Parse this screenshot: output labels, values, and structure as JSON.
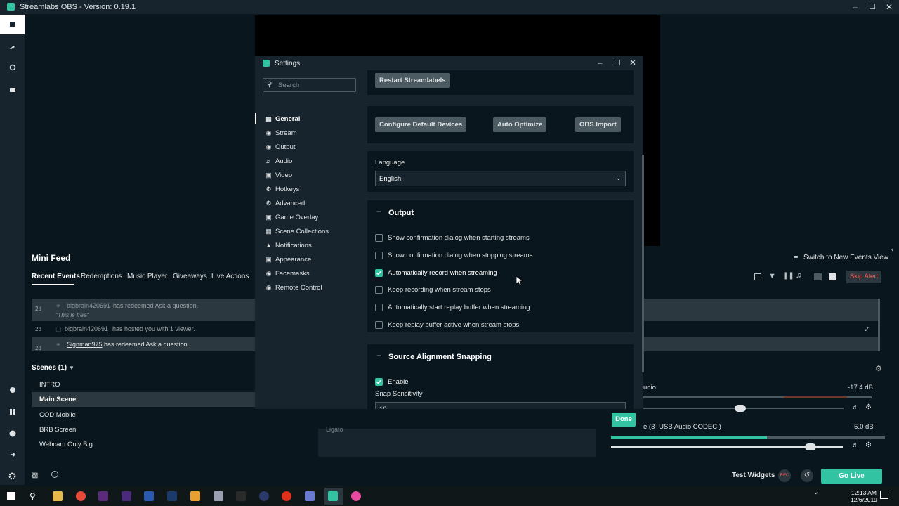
{
  "window": {
    "title": "Streamlabs OBS - Version: 0.19.1"
  },
  "mini_feed": {
    "title": "Mini Feed",
    "tabs": [
      "Recent Events",
      "Redemptions",
      "Music Player",
      "Giveaways",
      "Live Actions"
    ],
    "events": [
      {
        "age": "2d",
        "user": "bigbrain420691",
        "text": "has redeemed Ask a question.",
        "quote": "\"This is free\""
      },
      {
        "age": "2d",
        "user": "bigbrain420691",
        "text": "has hosted you with 1 viewer."
      },
      {
        "age": "2d",
        "user": "Signman975",
        "text": "has redeemed Ask a question."
      }
    ],
    "switch_label": "Switch to New Events View",
    "skip_alert": "Skip Alert"
  },
  "scenes": {
    "title": "Scenes (1)",
    "items": [
      "INTRO",
      "Main Scene",
      "COD Mobile",
      "BRB Screen",
      "Webcam Only Big"
    ],
    "selected": "Main Scene"
  },
  "sources": {
    "partial_item": "Ligato"
  },
  "mixer": {
    "items": [
      {
        "label": "udio",
        "db": "-17.4 dB"
      },
      {
        "label": "e (3- USB Audio CODEC )",
        "db": "-5.0 dB"
      }
    ]
  },
  "footer": {
    "test_widgets": "Test Widgets",
    "rec_label": "REC",
    "go_live": "Go Live"
  },
  "taskbar": {
    "time": "12:13 AM",
    "date": "12/6/2019"
  },
  "settings": {
    "title": "Settings",
    "search_placeholder": "Search",
    "nav": [
      {
        "label": "General",
        "icon": "grid-icon"
      },
      {
        "label": "Stream",
        "icon": "globe-icon"
      },
      {
        "label": "Output",
        "icon": "output-icon"
      },
      {
        "label": "Audio",
        "icon": "speaker-icon"
      },
      {
        "label": "Video",
        "icon": "film-icon"
      },
      {
        "label": "Hotkeys",
        "icon": "keyboard-icon"
      },
      {
        "label": "Advanced",
        "icon": "gears-icon"
      },
      {
        "label": "Game Overlay",
        "icon": "overlay-icon"
      },
      {
        "label": "Scene Collections",
        "icon": "collections-icon"
      },
      {
        "label": "Notifications",
        "icon": "bell-icon"
      },
      {
        "label": "Appearance",
        "icon": "brush-icon"
      },
      {
        "label": "Facemasks",
        "icon": "mask-icon"
      },
      {
        "label": "Remote Control",
        "icon": "remote-icon"
      }
    ],
    "active_nav": "General",
    "buttons": {
      "restart_streamlabels": "Restart Streamlabels",
      "configure_default_devices": "Configure Default Devices",
      "auto_optimize": "Auto Optimize",
      "obs_import": "OBS Import"
    },
    "language": {
      "label": "Language",
      "value": "English"
    },
    "output": {
      "title": "Output",
      "options": [
        {
          "label": "Show confirmation dialog when starting streams",
          "checked": false
        },
        {
          "label": "Show confirmation dialog when stopping streams",
          "checked": false
        },
        {
          "label": "Automatically record when streaming",
          "checked": true
        },
        {
          "label": "Keep recording when stream stops",
          "checked": false
        },
        {
          "label": "Automatically start replay buffer when streaming",
          "checked": false
        },
        {
          "label": "Keep replay buffer active when stream stops",
          "checked": false
        }
      ]
    },
    "snapping": {
      "title": "Source Alignment Snapping",
      "enable_label": "Enable",
      "enabled": true,
      "sensitivity_label": "Snap Sensitivity",
      "sensitivity_value": "10"
    },
    "done_label": "Done"
  },
  "colors": {
    "accent": "#31c3a2",
    "bg": "#09161d",
    "panel": "#17242d",
    "button": "#4c5a61"
  }
}
